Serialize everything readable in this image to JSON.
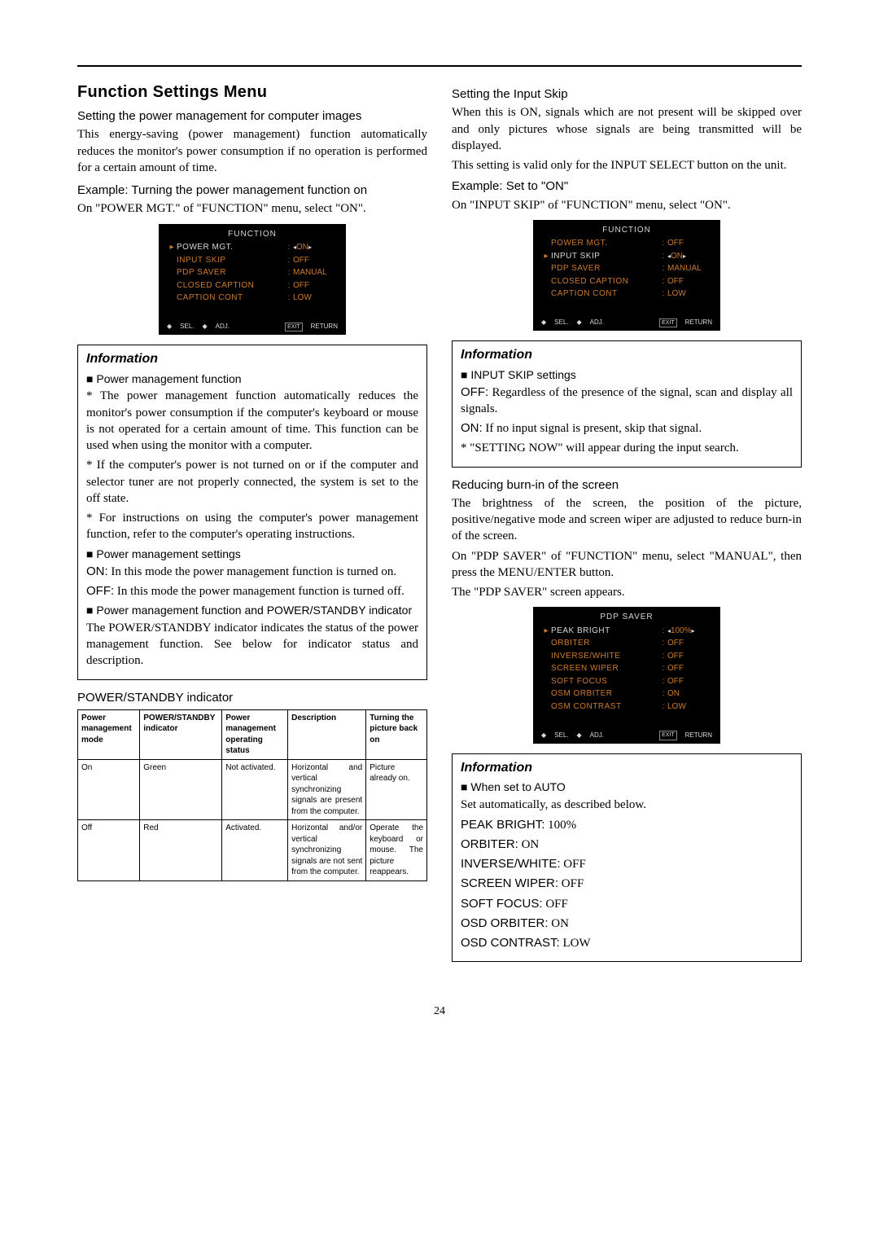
{
  "page": {
    "title": "Function Settings Menu",
    "pagenum": "24"
  },
  "left": {
    "sec1_head": "Setting the power management for computer images",
    "sec1_p1": "This energy-saving (power management) function automatically reduces the monitor's power consumption if no operation is performed for a certain amount of time.",
    "sec1_ex": "Example: Turning the power management function on",
    "sec1_instr": "On \"POWER MGT.\" of \"FUNCTION\" menu, select \"ON\".",
    "info_title": "Information",
    "info1_h1": "Power management function",
    "info1_p1": "* The power management function automatically reduces the monitor's power consumption if the computer's keyboard or mouse is not operated for a certain amount of time. This function can be used when using the monitor with a computer.",
    "info1_p2": "* If the computer's power is not turned on or if the computer and selector tuner are not properly connected, the system is set to the off state.",
    "info1_p3": "* For instructions on using the computer's power management function, refer to the computer's operating instructions.",
    "info1_h2": "Power management settings",
    "info1_on_label": "ON:",
    "info1_on_text": " In this mode the power management function is turned on.",
    "info1_off_label": "OFF:",
    "info1_off_text": " In this mode the power management function is turned off.",
    "info1_h3": "Power management function and POWER/STANDBY indicator",
    "info1_p4": "The POWER/STANDBY indicator indicates the status of the power management function. See below for indicator status and description.",
    "table_title": "POWER/STANDBY indicator",
    "table_headers": {
      "c1": "Power management mode",
      "c2": "POWER/STANDBY indicator",
      "c3": "Power management operating status",
      "c4": "Description",
      "c5": "Turning the picture back on"
    },
    "table_rows": [
      {
        "c1": "On",
        "c2": "Green",
        "c3": "Not activated.",
        "c4": "Horizontal and vertical synchronizing signals are present from the computer.",
        "c5": "Picture already on."
      },
      {
        "c1": "Off",
        "c2": "Red",
        "c3": "Activated.",
        "c4": "Horizontal and/or vertical synchronizing signals are not sent from the computer.",
        "c5": "Operate the keyboard or mouse. The picture reappears."
      }
    ]
  },
  "right": {
    "sec2_head": "Setting the Input Skip",
    "sec2_p1": "When this is ON, signals which are not present will be skipped over and only pictures whose signals are being transmitted will be displayed.",
    "sec2_p2": "This setting is valid only for the INPUT SELECT button on the unit.",
    "sec2_ex": "Example: Set to \"ON\"",
    "sec2_instr": "On \"INPUT SKIP\" of \"FUNCTION\" menu, select \"ON\".",
    "info2_title": "Information",
    "info2_h1": "INPUT SKIP settings",
    "info2_off_label": "OFF:",
    "info2_off_text": " Regardless of the presence of the signal, scan and display all signals.",
    "info2_on_label": "ON:",
    "info2_on_text": " If no input signal is present, skip that signal.",
    "info2_note": "* \"SETTING NOW\" will appear during the input search.",
    "sec3_head": "Reducing burn-in of the screen",
    "sec3_p1": "The brightness of the screen, the position of the picture, positive/negative mode and screen wiper are adjusted to reduce burn-in of the screen.",
    "sec3_p2": "On \"PDP SAVER\" of \"FUNCTION\" menu, select \"MANUAL\", then press the MENU/ENTER button.",
    "sec3_p3": "The \"PDP SAVER\" screen appears.",
    "info3_title": "Information",
    "info3_h1": "When set to AUTO",
    "info3_p1": "Set automatically, as described below.",
    "info3_l1_k": "PEAK BRIGHT:",
    "info3_l1_v": " 100%",
    "info3_l2_k": "ORBITER:",
    "info3_l2_v": " ON",
    "info3_l3_k": "INVERSE/WHITE:",
    "info3_l3_v": " OFF",
    "info3_l4_k": "SCREEN WIPER:",
    "info3_l4_v": " OFF",
    "info3_l5_k": "SOFT FOCUS:",
    "info3_l5_v": " OFF",
    "info3_l6_k": "OSD ORBITER:",
    "info3_l6_v": " ON",
    "info3_l7_k": "OSD CONTRAST:",
    "info3_l7_v": " LOW"
  },
  "osd1": {
    "title": "FUNCTION",
    "rows": [
      {
        "sel": true,
        "label": "POWER MGT.",
        "val": "ON",
        "lr": true
      },
      {
        "sel": false,
        "label": "INPUT SKIP",
        "val": "OFF"
      },
      {
        "sel": false,
        "label": "PDP SAVER",
        "val": "MANUAL"
      },
      {
        "sel": false,
        "label": "CLOSED CAPTION",
        "val": "OFF"
      },
      {
        "sel": false,
        "label": "CAPTION CONT",
        "val": "LOW"
      }
    ],
    "foot": {
      "sel": "SEL.",
      "adj": "ADJ.",
      "exit": "EXIT",
      "ret": "RETURN"
    }
  },
  "osd2": {
    "title": "FUNCTION",
    "rows": [
      {
        "sel": false,
        "label": "POWER MGT.",
        "val": "OFF"
      },
      {
        "sel": true,
        "label": "INPUT SKIP",
        "val": "ON",
        "lr": true
      },
      {
        "sel": false,
        "label": "PDP SAVER",
        "val": "MANUAL"
      },
      {
        "sel": false,
        "label": "CLOSED CAPTION",
        "val": "OFF"
      },
      {
        "sel": false,
        "label": "CAPTION CONT",
        "val": "LOW"
      }
    ],
    "foot": {
      "sel": "SEL.",
      "adj": "ADJ.",
      "exit": "EXIT",
      "ret": "RETURN"
    }
  },
  "osd3": {
    "title": "PDP SAVER",
    "rows": [
      {
        "sel": true,
        "label": "PEAK BRIGHT",
        "val": "100%",
        "lr": true
      },
      {
        "sel": false,
        "label": "ORBITER",
        "val": "OFF"
      },
      {
        "sel": false,
        "label": "INVERSE/WHITE",
        "val": "OFF"
      },
      {
        "sel": false,
        "label": "SCREEN WIPER",
        "val": "OFF"
      },
      {
        "sel": false,
        "label": "SOFT FOCUS",
        "val": "OFF"
      },
      {
        "sel": false,
        "label": "OSM ORBITER",
        "val": "ON"
      },
      {
        "sel": false,
        "label": "OSM CONTRAST",
        "val": "LOW"
      }
    ],
    "foot": {
      "sel": "SEL.",
      "adj": "ADJ.",
      "exit": "EXIT",
      "ret": "RETURN"
    }
  }
}
